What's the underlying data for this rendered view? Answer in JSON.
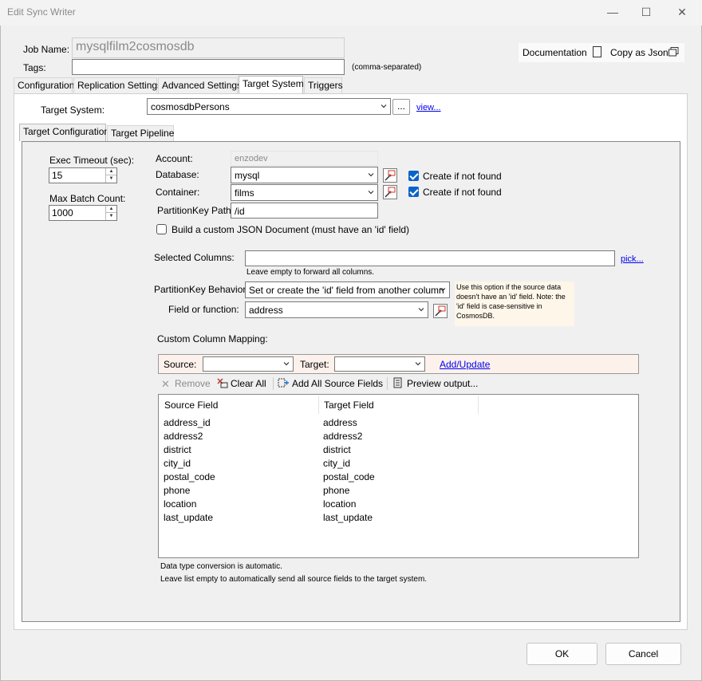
{
  "window": {
    "title": "Edit Sync Writer"
  },
  "header": {
    "job_name_label": "Job Name:",
    "job_name_value": "mysqlfilm2cosmosdb",
    "tags_label": "Tags:",
    "tags_value": "",
    "tags_hint": "(comma-separated)",
    "documentation_label": "Documentation",
    "copy_json_label": "Copy as Json"
  },
  "main_tabs": [
    "Configuration",
    "Replication Settings",
    "Advanced Settings",
    "Target System",
    "Triggers"
  ],
  "target": {
    "label": "Target System:",
    "value": "cosmosdbPersons",
    "ellipsis": "...",
    "view_link": "view..."
  },
  "sub_tabs": [
    "Target Configuration",
    "Target Pipeline"
  ],
  "exec": {
    "timeout_label": "Exec Timeout (sec):",
    "timeout_value": "15",
    "batch_label": "Max Batch Count:",
    "batch_value": "1000"
  },
  "cosmos": {
    "account_label": "Account:",
    "account_value": "enzodev",
    "database_label": "Database:",
    "database_value": "mysql",
    "container_label": "Container:",
    "container_value": "films",
    "pk_path_label": "PartitionKey Path:",
    "pk_path_value": "/id",
    "create_db_label": "Create if not found",
    "create_db_checked": true,
    "create_container_label": "Create if not found",
    "create_container_checked": true,
    "custom_json_label": "Build a custom JSON Document (must have an 'id' field)",
    "custom_json_checked": false
  },
  "columns": {
    "selected_label": "Selected Columns:",
    "selected_value": "",
    "hint": "Leave empty to forward all columns.",
    "pick_link": "pick...",
    "pk_behavior_label": "PartitionKey Behavior:",
    "pk_behavior_value": "Set or create the 'id' field from another column",
    "field_label": "Field or function:",
    "field_value": "address",
    "note": "Use this option if the source data doesn't have an 'id' field. Note: the 'id' field is case-sensitive in CosmosDB."
  },
  "mapping": {
    "title": "Custom Column Mapping:",
    "source_label": "Source:",
    "target_label": "Target:",
    "add_update_link": "Add/Update",
    "remove_label": "Remove",
    "clear_all_label": "Clear All",
    "add_all_label": "Add All Source Fields",
    "preview_label": "Preview output...",
    "col_source": "Source Field",
    "col_target": "Target Field",
    "rows": [
      [
        "address_id",
        "address"
      ],
      [
        "address2",
        "address2"
      ],
      [
        "district",
        "district"
      ],
      [
        "city_id",
        "city_id"
      ],
      [
        "postal_code",
        "postal_code"
      ],
      [
        "phone",
        "phone"
      ],
      [
        "location",
        "location"
      ],
      [
        "last_update",
        "last_update"
      ]
    ],
    "footnote1": "Data type conversion is automatic.",
    "footnote2": "Leave list empty to automatically send all source fields to the target system."
  },
  "buttons": {
    "ok": "OK",
    "cancel": "Cancel"
  }
}
